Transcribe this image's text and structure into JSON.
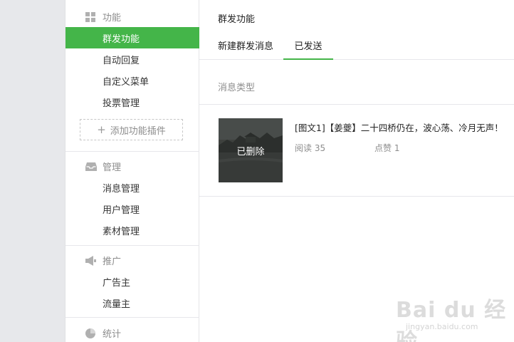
{
  "sidebar": {
    "sections": [
      {
        "title": "功能",
        "icon": "grid-icon",
        "items": [
          "群发功能",
          "自动回复",
          "自定义菜单",
          "投票管理"
        ],
        "active_index": 0,
        "add_plugin_label": "添加功能插件"
      },
      {
        "title": "管理",
        "icon": "inbox-icon",
        "items": [
          "消息管理",
          "用户管理",
          "素材管理"
        ]
      },
      {
        "title": "推广",
        "icon": "megaphone-icon",
        "items": [
          "广告主",
          "流量主"
        ]
      },
      {
        "title": "统计",
        "icon": "pie-chart-icon",
        "items": []
      }
    ]
  },
  "main": {
    "page_title": "群发功能",
    "tabs": [
      {
        "label": "新建群发消息",
        "active": false
      },
      {
        "label": "已发送",
        "active": true
      }
    ],
    "filter_label": "消息类型",
    "messages": [
      {
        "thumb_status": "已删除",
        "title": "[图文1]【姜夔】二十四桥仍在，波心荡、冷月无声！",
        "read_label": "阅读",
        "read_count": "35",
        "like_label": "点赞",
        "like_count": "1"
      }
    ]
  },
  "watermark": {
    "brand": "Bai du 经验",
    "url": "jingyan.baidu.com"
  },
  "colors": {
    "accent": "#44b549",
    "muted": "#8d8d8d",
    "background": "#e7e8eb"
  }
}
